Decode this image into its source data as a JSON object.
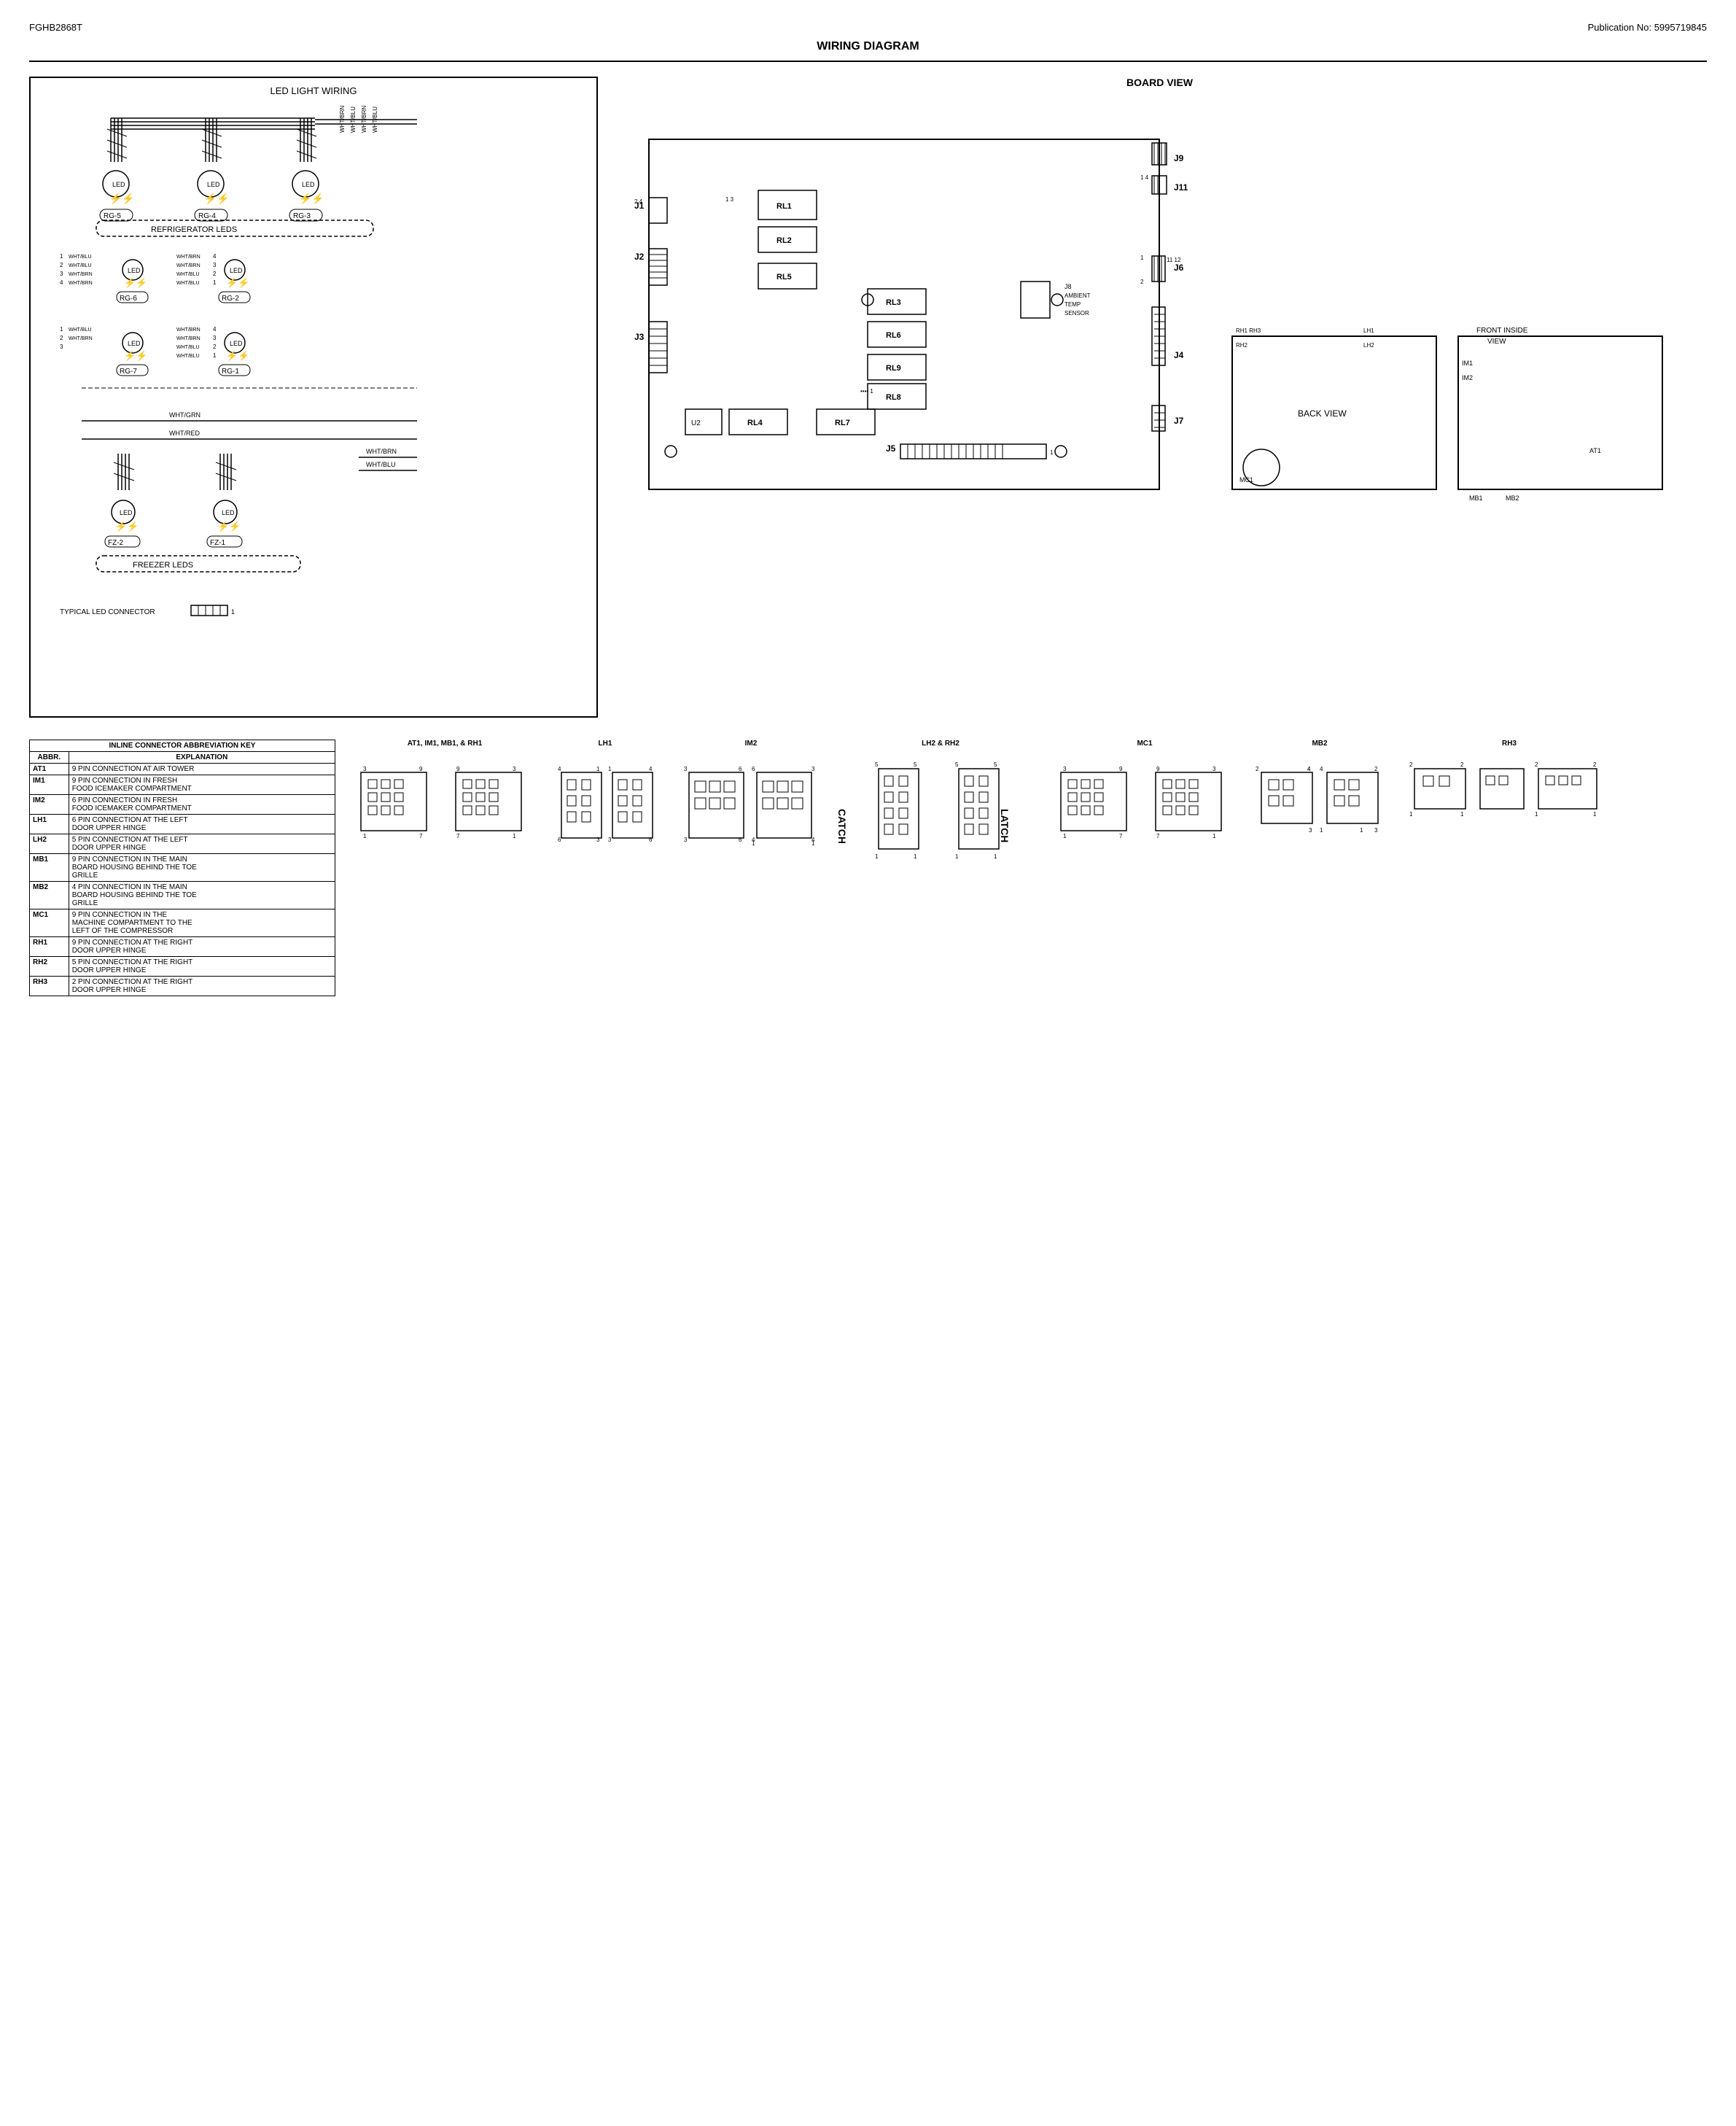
{
  "header": {
    "model": "FGHB2868T",
    "publication": "Publication No:  5995719845"
  },
  "title": "WIRING DIAGRAM",
  "led_wiring": {
    "title": "LED LIGHT WIRING",
    "ref_groups": [
      "RG-5",
      "RG-4",
      "RG-3",
      "RG-6",
      "RG-2",
      "RG-7",
      "RG-1"
    ],
    "sections": [
      "REFRIGERATOR LEDS",
      "FREEZER LEDS"
    ],
    "freezer_groups": [
      "FZ-2",
      "FZ-1"
    ],
    "connector_label": "TYPICAL LED CONNECTOR",
    "wire_labels": [
      "WHT/BLU",
      "WHT/BRN",
      "WHT/BLU",
      "WHT/BRN",
      "WHT/BRN",
      "WHT/BLU",
      "WHT/GRN",
      "WHT/RED",
      "WHT/BRN",
      "WHT/BLU"
    ]
  },
  "board_view": {
    "title": "BOARD VIEW",
    "connectors": [
      "J1",
      "J2",
      "J3",
      "J4",
      "J5",
      "J6",
      "J7",
      "J8",
      "J9",
      "J11"
    ],
    "relays": [
      "RL1",
      "RL2",
      "RL3",
      "RL4",
      "RL5",
      "RL6",
      "RL7",
      "RL8",
      "RL9"
    ],
    "j8_label": "J8\nAMBIENT\nTEMP\nSENSOR",
    "u2_label": "U2"
  },
  "back_view_label": "BACK VIEW",
  "front_inside_view_label": "FRONT INSIDE\nVIEW",
  "abbreviation_table": {
    "header_abbr": "ABBR.",
    "header_explanation": "EXPLANATION",
    "title": "INLINE CONNECTOR ABBREVIATION KEY",
    "rows": [
      {
        "abbr": "AT1",
        "explanation": "9 PIN CONNECTION AT AIR TOWER"
      },
      {
        "abbr": "IM1",
        "explanation": "9 PIN CONNECTION IN FRESH\nFOOD ICEMAKER COMPARTMENT"
      },
      {
        "abbr": "IM2",
        "explanation": "6 PIN CONNECTION IN FRESH\nFOOD ICEMAKER COMPARTMENT"
      },
      {
        "abbr": "LH1",
        "explanation": "6 PIN CONNECTION AT THE LEFT\nDOOR UPPER HINGE"
      },
      {
        "abbr": "LH2",
        "explanation": "5 PIN CONNECTION AT THE LEFT\nDOOR UPPER HINGE"
      },
      {
        "abbr": "MB1",
        "explanation": "9 PIN CONNECTION IN THE MAIN\nBOARD HOUSING BEHIND THE TOE\nGRILLE"
      },
      {
        "abbr": "MB2",
        "explanation": "4 PIN CONNECTION IN THE MAIN\nBOARD HOUSING BEHIND THE TOE\nGRILLE"
      },
      {
        "abbr": "MC1",
        "explanation": "9 PIN CONNECTION IN THE\nMACHINE COMPARTMENT TO THE\nLEFT OF THE COMPRESSOR"
      },
      {
        "abbr": "RH1",
        "explanation": "9 PIN CONNECTION AT THE RIGHT\nDOOR UPPER HINGE"
      },
      {
        "abbr": "RH2",
        "explanation": "5 PIN CONNECTION AT THE RIGHT\nDOOR UPPER HINGE"
      },
      {
        "abbr": "RH3",
        "explanation": "2 PIN CONNECTION AT THE RIGHT\nDOOR UPPER HINGE"
      }
    ]
  },
  "connector_diagrams": [
    {
      "label": "AT1, IM1, MB1, & RH1",
      "type": "9pin_double"
    },
    {
      "label": "LH1",
      "type": "6pin"
    },
    {
      "label": "IM2",
      "type": "6pin_alt"
    },
    {
      "label": "LH2 & RH2",
      "type": "5pin"
    },
    {
      "label": "MC1",
      "type": "9pin_double"
    },
    {
      "label": "MB2",
      "type": "4pin"
    },
    {
      "label": "RH3",
      "type": "2pin"
    }
  ],
  "catch_label": "CATCH",
  "latch_label": "LATCH"
}
